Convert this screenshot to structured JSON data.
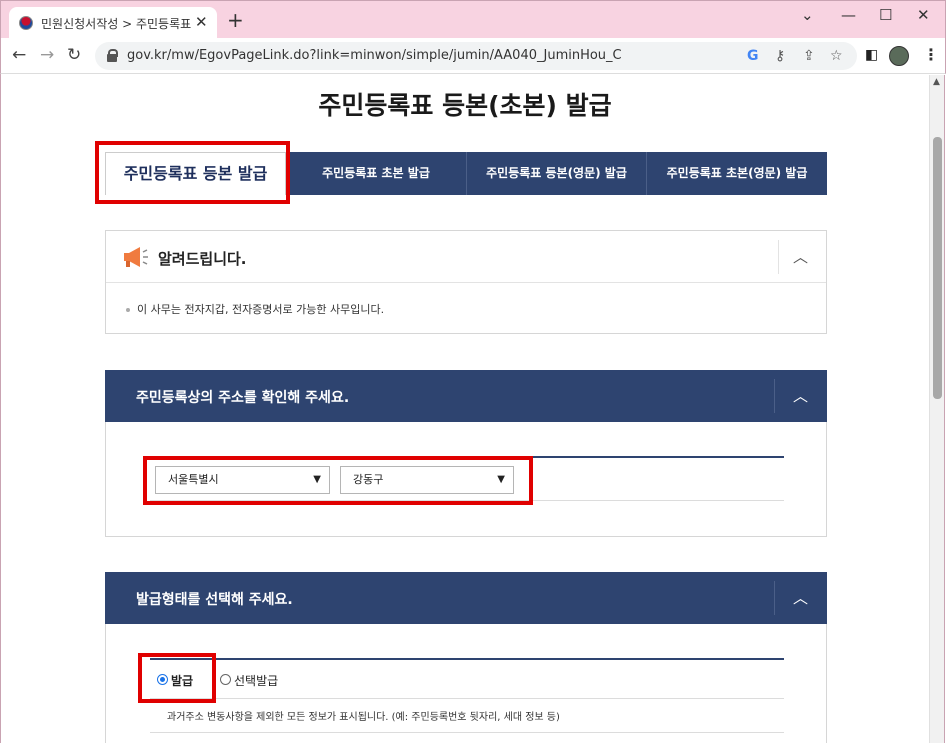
{
  "browser": {
    "tab_title": "민원신청서작성 > 주민등록표 등",
    "tab_close": "✕",
    "new_tab": "+",
    "url": "gov.kr/mw/EgovPageLink.do?link=minwon/simple/jumin/AA040_JuminHou_C",
    "window_controls": {
      "minimize": "—",
      "maximize": "☐",
      "close": "✕",
      "dropdown": "⌄"
    },
    "icons": [
      "back-icon",
      "forward-icon",
      "reload-icon",
      "lock-icon",
      "google-icon",
      "key-icon",
      "share-icon",
      "star-icon",
      "sidepanel-icon",
      "profile-avatar",
      "menu-icon"
    ]
  },
  "page": {
    "title": "주민등록표 등본(초본) 발급",
    "tabs": [
      {
        "label": "주민등록표 등본 발급",
        "active": true
      },
      {
        "label": "주민등록표 초본 발급"
      },
      {
        "label": "주민등록표 등본(영문) 발급"
      },
      {
        "label": "주민등록표 초본(영문) 발급"
      }
    ],
    "notice": {
      "title": "알려드립니다.",
      "body": "이 사무는 전자지갑, 전자증명서로 가능한 사무입니다."
    },
    "address_section": {
      "title": "주민등록상의 주소를 확인해 주세요.",
      "city_select": {
        "value": "서울특별시"
      },
      "district_select": {
        "value": "강동구"
      }
    },
    "type_section": {
      "title": "발급형태를 선택해 주세요.",
      "options": [
        {
          "label": "발급",
          "selected": true
        },
        {
          "label": "선택발급",
          "selected": false
        }
      ],
      "description": "과거주소 변동사항을 제외한 모든 정보가 표시됩니다. (예: 주민등록번호 뒷자리, 세대 정보 등)"
    }
  },
  "colors": {
    "navy": "#2e4470",
    "highlight": "#e00000",
    "tab_bar": "#f8d3e1"
  }
}
